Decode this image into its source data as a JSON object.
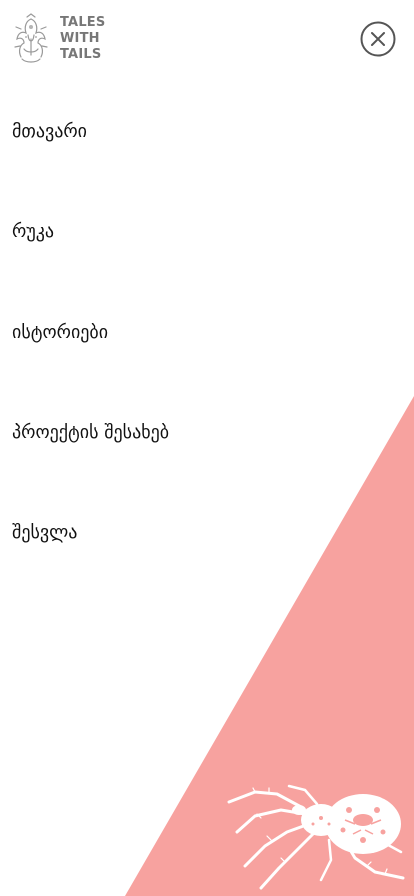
{
  "brand": {
    "logo_lines": [
      "TALES",
      "WITH",
      "TAILS"
    ],
    "text_color": "#777777"
  },
  "header": {
    "close_icon": "close-icon"
  },
  "menu": {
    "items": [
      {
        "label": "მთავარი"
      },
      {
        "label": "რუკა"
      },
      {
        "label": "ისტორიები"
      },
      {
        "label": "პროექტის შესახებ"
      },
      {
        "label": "შესვლა"
      }
    ]
  },
  "colors": {
    "accent": "#f7a29f",
    "background": "#ffffff",
    "text": "#111111",
    "icon": "#555555"
  },
  "decoration": {
    "background_shape": "diagonal-triangle",
    "illustration": "spider-illustration"
  }
}
